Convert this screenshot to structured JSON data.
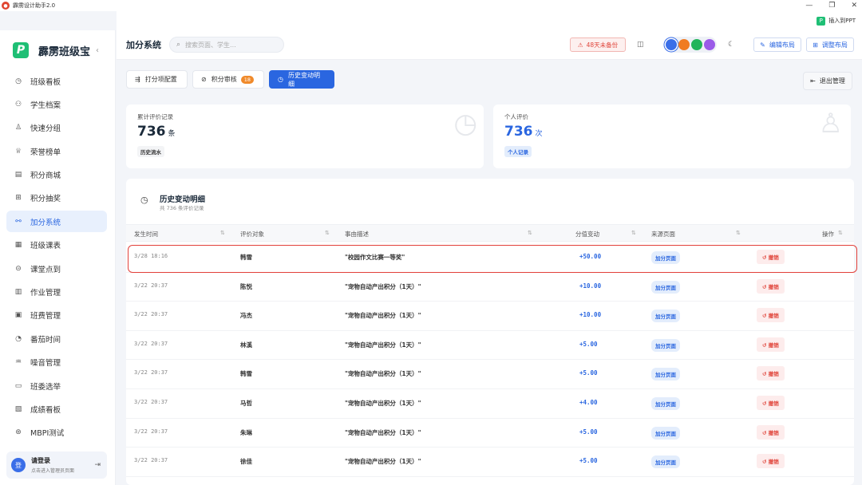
{
  "window": {
    "title": "霹雳设计助手2.0",
    "insert_ppt": "插入到PPT"
  },
  "brand": {
    "name": "霹雳班级宝"
  },
  "sidebar": {
    "items": [
      {
        "label": "班级看板",
        "icon": "◷"
      },
      {
        "label": "学生档案",
        "icon": "⚇"
      },
      {
        "label": "快速分组",
        "icon": "♙"
      },
      {
        "label": "荣誉榜单",
        "icon": "♕"
      },
      {
        "label": "积分商城",
        "icon": "▤"
      },
      {
        "label": "积分抽奖",
        "icon": "⊞"
      },
      {
        "label": "加分系统",
        "icon": "⚯"
      },
      {
        "label": "班级课表",
        "icon": "▦"
      },
      {
        "label": "课堂点到",
        "icon": "⊝"
      },
      {
        "label": "作业管理",
        "icon": "▥"
      },
      {
        "label": "班费管理",
        "icon": "▣"
      },
      {
        "label": "番茄时间",
        "icon": "◔"
      },
      {
        "label": "噪音管理",
        "icon": "♒"
      },
      {
        "label": "班委选举",
        "icon": "▭"
      },
      {
        "label": "成绩看板",
        "icon": "▧"
      },
      {
        "label": "MBPI测试",
        "icon": "⊛"
      }
    ],
    "active_index": 6,
    "login": {
      "avatar": "登",
      "title": "请登录",
      "subtitle": "点击进入管理员页面"
    }
  },
  "header": {
    "page_title": "加分系统",
    "search_placeholder": "搜索页面、学生...",
    "backup_warning": "48天未备份",
    "theme_colors": [
      "#3a6ee8",
      "#f07b22",
      "#22b45a",
      "#9b5be8"
    ],
    "edit_layout": "编辑布局",
    "adjust_layout": "调整布局"
  },
  "tabs": [
    {
      "label": "打分项配置",
      "icon": "⇶"
    },
    {
      "label": "积分审核",
      "icon": "⊘",
      "badge": "18"
    },
    {
      "label": "历史变动明细",
      "icon": "◷"
    }
  ],
  "exit_button": "退出管理",
  "stats": [
    {
      "label": "累计评价记录",
      "value": "736",
      "unit": "条",
      "tag": "历史流水"
    },
    {
      "label": "个人评价",
      "value": "736",
      "unit": "次",
      "tag": "个人记录"
    }
  ],
  "history": {
    "title": "历史变动明细",
    "subtitle": "共 736 条评价记录",
    "columns": [
      "发生时间",
      "评价对象",
      "事由描述",
      "分值变动",
      "来源页面",
      "操作"
    ],
    "rows": [
      {
        "time": "3/28 18:16",
        "name": "韩雪",
        "desc": "\"校园作文比赛一等奖\"",
        "value": "+50.00",
        "source": "加分页面",
        "action": "撤销"
      },
      {
        "time": "3/22 20:37",
        "name": "陈悦",
        "desc": "\"宠物自动产出积分（1天）\"",
        "value": "+10.00",
        "source": "加分页面",
        "action": "撤销"
      },
      {
        "time": "3/22 20:37",
        "name": "冯杰",
        "desc": "\"宠物自动产出积分（1天）\"",
        "value": "+10.00",
        "source": "加分页面",
        "action": "撤销"
      },
      {
        "time": "3/22 20:37",
        "name": "林溪",
        "desc": "\"宠物自动产出积分（1天）\"",
        "value": "+5.00",
        "source": "加分页面",
        "action": "撤销"
      },
      {
        "time": "3/22 20:37",
        "name": "韩雪",
        "desc": "\"宠物自动产出积分（1天）\"",
        "value": "+5.00",
        "source": "加分页面",
        "action": "撤销"
      },
      {
        "time": "3/22 20:37",
        "name": "马哲",
        "desc": "\"宠物自动产出积分（1天）\"",
        "value": "+4.00",
        "source": "加分页面",
        "action": "撤销"
      },
      {
        "time": "3/22 20:37",
        "name": "朱琳",
        "desc": "\"宠物自动产出积分（1天）\"",
        "value": "+5.00",
        "source": "加分页面",
        "action": "撤销"
      },
      {
        "time": "3/22 20:37",
        "name": "徐佳",
        "desc": "\"宠物自动产出积分（1天）\"",
        "value": "+5.00",
        "source": "加分页面",
        "action": "撤销"
      }
    ]
  }
}
